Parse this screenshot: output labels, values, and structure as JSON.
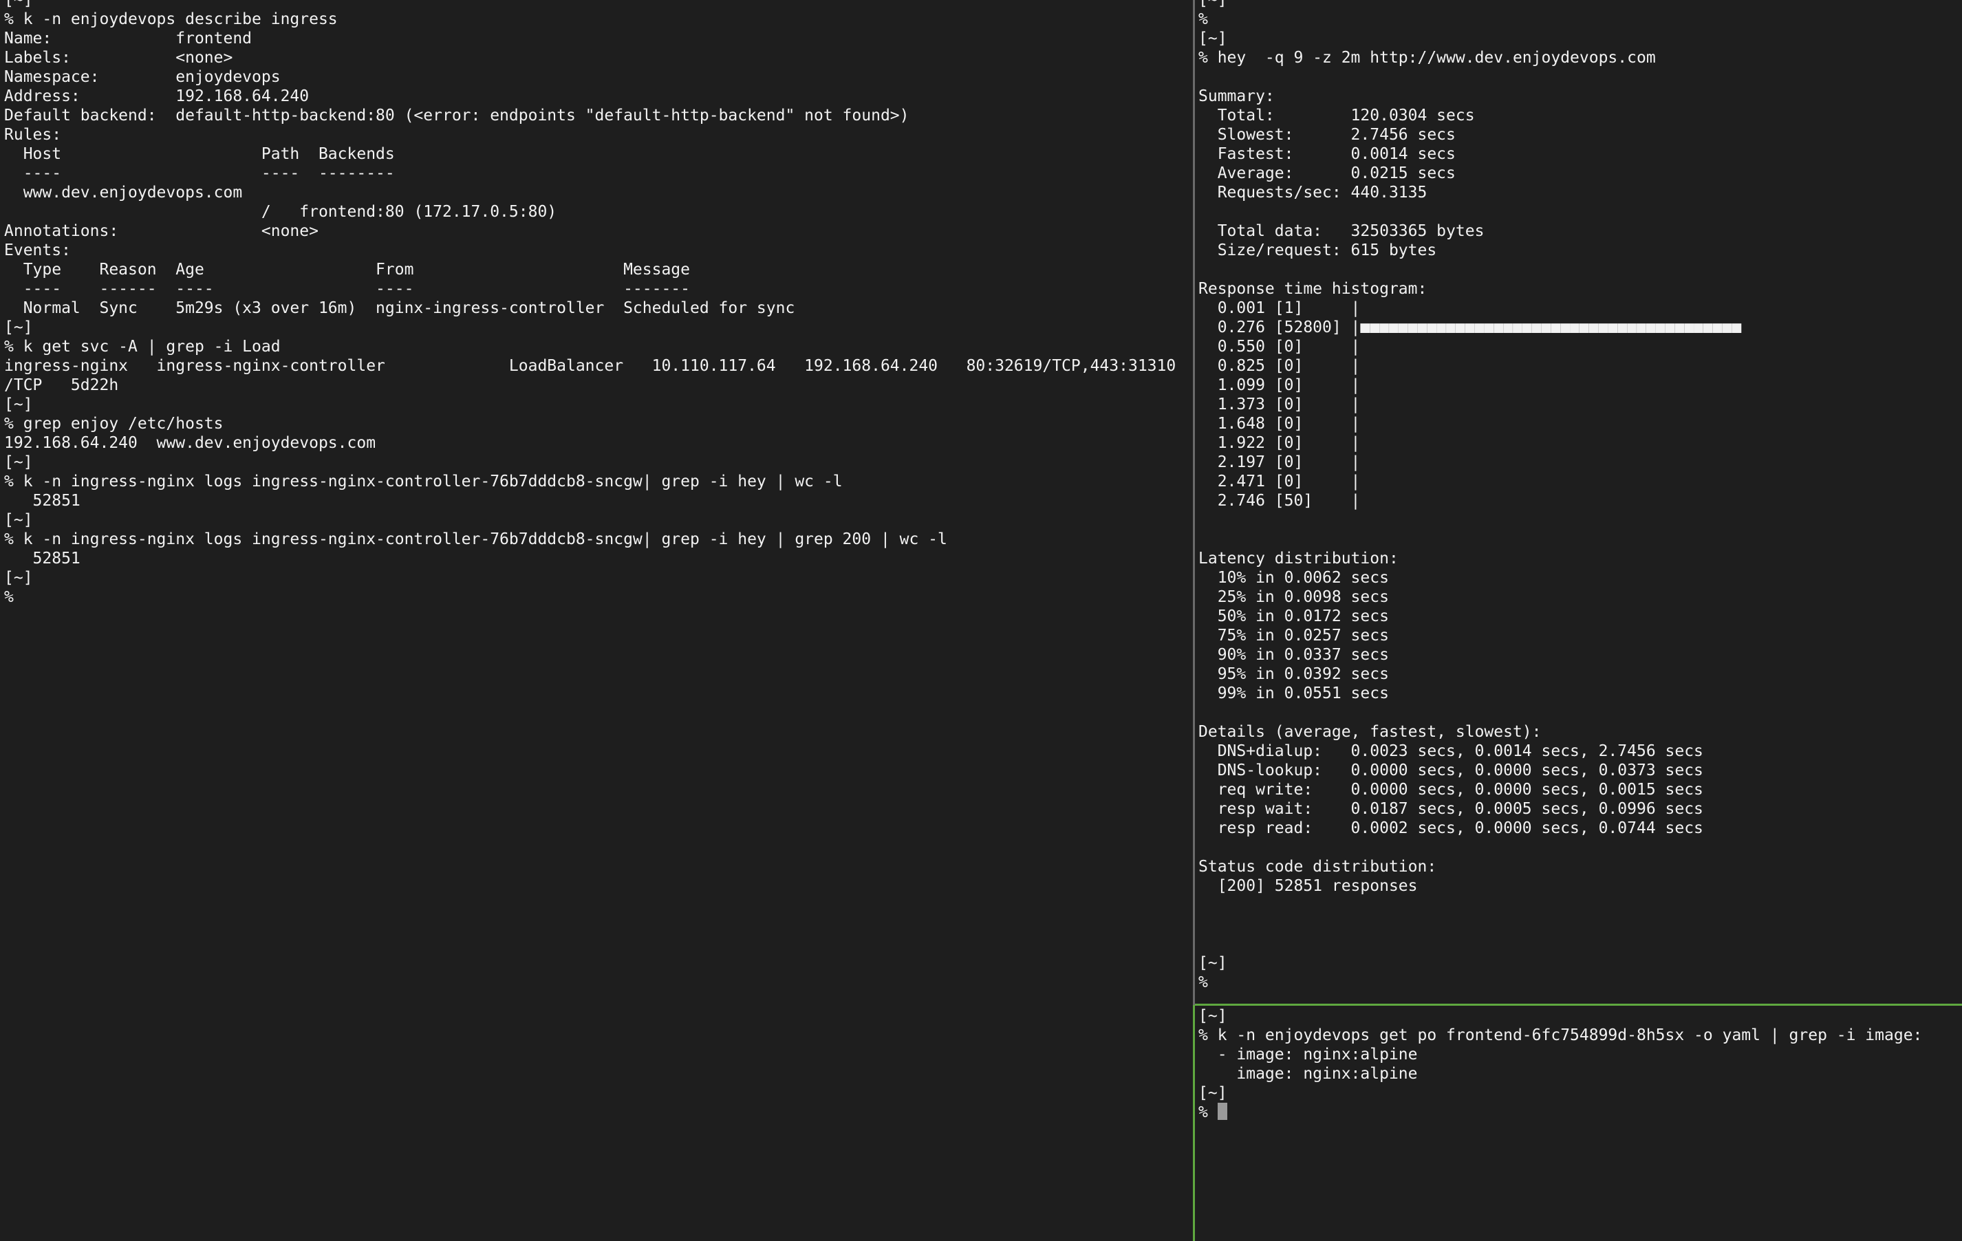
{
  "left_pane": {
    "lines": [
      "[~]",
      "% k -n enjoydevops describe ingress",
      "Name:             frontend",
      "Labels:           <none>",
      "Namespace:        enjoydevops",
      "Address:          192.168.64.240",
      "Default backend:  default-http-backend:80 (<error: endpoints \"default-http-backend\" not found>)",
      "Rules:",
      "  Host                     Path  Backends",
      "  ----                     ----  --------",
      "  www.dev.enjoydevops.com",
      "                           /   frontend:80 (172.17.0.5:80)",
      "Annotations:               <none>",
      "Events:",
      "  Type    Reason  Age                  From                      Message",
      "  ----    ------  ----                 ----                      -------",
      "  Normal  Sync    5m29s (x3 over 16m)  nginx-ingress-controller  Scheduled for sync",
      "[~]",
      "% k get svc -A | grep -i Load",
      "ingress-nginx   ingress-nginx-controller             LoadBalancer   10.110.117.64   192.168.64.240   80:32619/TCP,443:31310",
      "/TCP   5d22h",
      "[~]",
      "% grep enjoy /etc/hosts",
      "192.168.64.240  www.dev.enjoydevops.com",
      "[~]",
      "% k -n ingress-nginx logs ingress-nginx-controller-76b7dddcb8-sncgw| grep -i hey | wc -l",
      "   52851",
      "[~]",
      "% k -n ingress-nginx logs ingress-nginx-controller-76b7dddcb8-sncgw| grep -i hey | grep 200 | wc -l",
      "   52851",
      "[~]",
      "%"
    ]
  },
  "right_top_pane": {
    "lines": [
      "[~]",
      "%",
      "[~]",
      "% hey  -q 9 -z 2m http://www.dev.enjoydevops.com",
      "",
      "Summary:",
      "  Total:        120.0304 secs",
      "  Slowest:      2.7456 secs",
      "  Fastest:      0.0014 secs",
      "  Average:      0.0215 secs",
      "  Requests/sec: 440.3135",
      "",
      "  Total data:   32503365 bytes",
      "  Size/request: 615 bytes",
      "",
      "Response time histogram:",
      "  0.001 [1]     |",
      "  0.276 [52800] |■■■■■■■■■■■■■■■■■■■■■■■■■■■■■■■■■■■■■■■■",
      "  0.550 [0]     |",
      "  0.825 [0]     |",
      "  1.099 [0]     |",
      "  1.373 [0]     |",
      "  1.648 [0]     |",
      "  1.922 [0]     |",
      "  2.197 [0]     |",
      "  2.471 [0]     |",
      "  2.746 [50]    |",
      "",
      "",
      "Latency distribution:",
      "  10% in 0.0062 secs",
      "  25% in 0.0098 secs",
      "  50% in 0.0172 secs",
      "  75% in 0.0257 secs",
      "  90% in 0.0337 secs",
      "  95% in 0.0392 secs",
      "  99% in 0.0551 secs",
      "",
      "Details (average, fastest, slowest):",
      "  DNS+dialup:   0.0023 secs, 0.0014 secs, 2.7456 secs",
      "  DNS-lookup:   0.0000 secs, 0.0000 secs, 0.0373 secs",
      "  req write:    0.0000 secs, 0.0000 secs, 0.0015 secs",
      "  resp wait:    0.0187 secs, 0.0005 secs, 0.0996 secs",
      "  resp read:    0.0002 secs, 0.0000 secs, 0.0744 secs",
      "",
      "Status code distribution:",
      "  [200] 52851 responses",
      "",
      "",
      "",
      "[~]",
      "%"
    ]
  },
  "right_bottom_pane": {
    "lines": [
      "[~]",
      "% k -n enjoydevops get po frontend-6fc754899d-8h5sx -o yaml | grep -i image:",
      "  - image: nginx:alpine",
      "    image: nginx:alpine",
      "[~]"
    ],
    "prompt": "% "
  },
  "colors": {
    "background": "#1e1e1e",
    "foreground": "#f2f2f2",
    "active_divider": "#5fa83f",
    "inactive_divider": "#6a6a6a",
    "cursor": "#9a9a9a"
  }
}
